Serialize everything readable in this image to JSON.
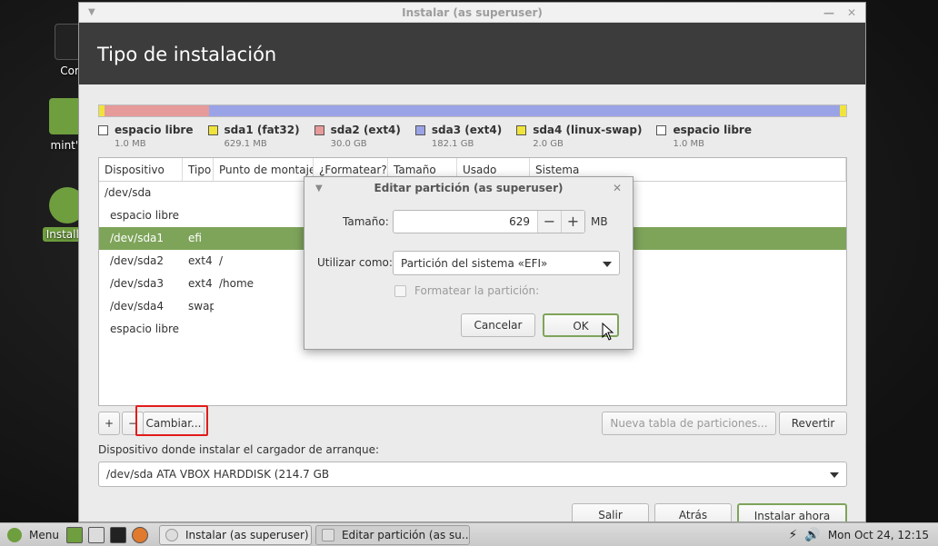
{
  "desktop": {
    "icons": [
      {
        "label": "Com"
      },
      {
        "label": "mint's"
      },
      {
        "label": "Install L"
      }
    ]
  },
  "window": {
    "title": "Instalar (as superuser)",
    "header": "Tipo de instalación"
  },
  "colors": {
    "free": "#ffffff",
    "fat32": "#f0e43c",
    "ext4_root": "#e69a9a",
    "ext4_home": "#9aa3e6",
    "swap": "#f0e43c",
    "accent": "#7ea45a",
    "highlight": "#e21b1b"
  },
  "partitions": [
    {
      "name": "espacio libre",
      "size": "1.0 MB",
      "fraction": 0.0,
      "color": "#ffffff"
    },
    {
      "name": "sda1 (fat32)",
      "size": "629.1 MB",
      "fraction": 0.003,
      "color": "#f0e43c"
    },
    {
      "name": "sda2 (ext4)",
      "size": "30.0 GB",
      "fraction": 0.14,
      "color": "#e69a9a"
    },
    {
      "name": "sda3 (ext4)",
      "size": "182.1 GB",
      "fraction": 0.848,
      "color": "#9aa3e6"
    },
    {
      "name": "sda4 (linux-swap)",
      "size": "2.0 GB",
      "fraction": 0.009,
      "color": "#f0e43c"
    },
    {
      "name": "espacio libre",
      "size": "1.0 MB",
      "fraction": 0.0,
      "color": "#ffffff"
    }
  ],
  "table": {
    "columns": [
      "Dispositivo",
      "Tipo",
      "Punto de montaje",
      "¿Formatear?",
      "Tamaño",
      "Usado",
      "Sistema"
    ],
    "rows": [
      {
        "device": "/dev/sda",
        "type": "",
        "mount": ""
      },
      {
        "device": "espacio libre",
        "type": "",
        "mount": ""
      },
      {
        "device": "/dev/sda1",
        "type": "efi",
        "mount": ""
      },
      {
        "device": "/dev/sda2",
        "type": "ext4",
        "mount": "/"
      },
      {
        "device": "/dev/sda3",
        "type": "ext4",
        "mount": "/home"
      },
      {
        "device": "/dev/sda4",
        "type": "swap",
        "mount": ""
      },
      {
        "device": "espacio libre",
        "type": "",
        "mount": ""
      }
    ],
    "selected_row": 2
  },
  "toolbar": {
    "add": "+",
    "remove": "−",
    "change": "Cambiar...",
    "new_table": "Nueva tabla de particiones...",
    "revert": "Revertir"
  },
  "bootloader": {
    "label": "Dispositivo donde instalar el cargador de arranque:",
    "value": "/dev/sda   ATA VBOX HARDDISK (214.7 GB"
  },
  "nav": {
    "quit": "Salir",
    "back": "Atrás",
    "install": "Instalar ahora"
  },
  "dialog": {
    "title": "Editar partición (as superuser)",
    "size_label": "Tamaño:",
    "size_value": "629",
    "size_unit": "MB",
    "use_label": "Utilizar como:",
    "use_value": "Partición del sistema «EFI»",
    "format_label": "Formatear la partición:",
    "cancel": "Cancelar",
    "ok": "OK"
  },
  "taskbar": {
    "menu": "Menu",
    "task1": "Instalar (as superuser)",
    "task2": "Editar partición (as su...",
    "clock": "Mon Oct 24, 12:15"
  }
}
